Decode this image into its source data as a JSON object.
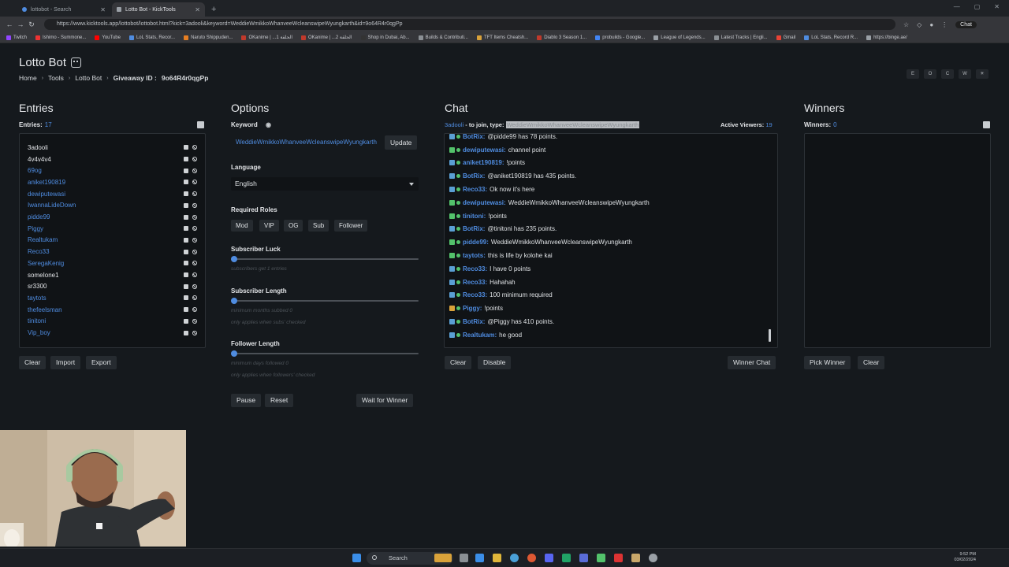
{
  "browser": {
    "tabs": [
      {
        "title": "lottobot - Search",
        "active": false
      },
      {
        "title": "Lotto Bot - KickTools",
        "active": true
      }
    ],
    "url": "https://www.kicktools.app/lottobot/lottobot.html?kick=3adooli&keyword=WeddieWmikkoWhanveeWcleanswipeWyungkarth&id=9o64R4r0qgPp",
    "chat_label": "Chat",
    "bookmarks": [
      "Twitch",
      "Ishimo - Summone...",
      "YouTube",
      "LoL Stats, Recor...",
      "Naruto Shippuden...",
      "OKanime | ...الحلقة 1",
      "OKanime | ...الحلقة 2",
      "Shop in Dubai, Ab...",
      "Builds & Contributi...",
      "TFT Items Cheatsh...",
      "Diablo 3 Season 1...",
      "probuilds - Google...",
      "League of Legends...",
      "Latest Tracks | Engli...",
      "Gmail",
      "LoL Stats, Record R...",
      "https://binge.ae/"
    ]
  },
  "header": {
    "title": "Lotto Bot",
    "breadcrumb": [
      "Home",
      "Tools",
      "Lotto Bot"
    ],
    "giveaway_label": "Giveaway ID :",
    "giveaway_id": "9o64R4r0qgPp",
    "top_buttons": [
      "E",
      "O",
      "C",
      "W",
      "☀"
    ]
  },
  "entries": {
    "title": "Entries",
    "count_label": "Entries:",
    "count": "17",
    "items": [
      {
        "name": "3adooli",
        "color": "#e3e5e8"
      },
      {
        "name": "4v4v4v4",
        "color": "#e3e5e8"
      },
      {
        "name": "69og",
        "color": "#4f8ce0"
      },
      {
        "name": "aniket190819",
        "color": "#4f8ce0"
      },
      {
        "name": "dewiputewasi",
        "color": "#4f8ce0"
      },
      {
        "name": "IwannaLideDown",
        "color": "#4f8ce0"
      },
      {
        "name": "pidde99",
        "color": "#4f8ce0"
      },
      {
        "name": "Piggy",
        "color": "#4f8ce0"
      },
      {
        "name": "Realtukam",
        "color": "#4f8ce0"
      },
      {
        "name": "Reco33",
        "color": "#4f8ce0"
      },
      {
        "name": "SeregaKenig",
        "color": "#4f8ce0"
      },
      {
        "name": "someIone1",
        "color": "#e3e5e8"
      },
      {
        "name": "sr3300",
        "color": "#e3e5e8"
      },
      {
        "name": "taytots",
        "color": "#4f8ce0"
      },
      {
        "name": "thefeelsman",
        "color": "#4f8ce0"
      },
      {
        "name": "tinitoni",
        "color": "#4f8ce0"
      },
      {
        "name": "Vip_boy",
        "color": "#4f8ce0"
      }
    ],
    "buttons": {
      "clear": "Clear",
      "import": "Import",
      "export": "Export"
    }
  },
  "options": {
    "title": "Options",
    "keyword_label": "Keyword",
    "keyword_value": "WeddieWmikkoWhanveeWcleanswipeWyungkarth",
    "update": "Update",
    "language_label": "Language",
    "language_value": "English",
    "roles_label": "Required Roles",
    "roles": [
      "Mod",
      "VIP",
      "OG",
      "Sub",
      "Follower"
    ],
    "sub_luck_label": "Subscriber Luck",
    "sub_luck_hint": "subscribers get 1 entries",
    "sub_length_label": "Subscriber Length",
    "sub_length_hint1": "minimum months subbed 0",
    "sub_length_hint2": "only applies when subs' checked",
    "follower_length_label": "Follower Length",
    "follower_length_hint1": "minimum days followed 0",
    "follower_length_hint2": "only applies when followers' checked",
    "pause": "Pause",
    "reset": "Reset",
    "wait": "Wait for Winner"
  },
  "chat": {
    "title": "Chat",
    "join_user": "3adooli",
    "join_text": "- to join, type:",
    "join_keyword": "WeddieWmikkoWhanveeWcleanswipeWyungkarth",
    "viewers_label": "Active Viewers:",
    "viewers": "19",
    "messages": [
      {
        "badge": "#5a9fd4",
        "user": "BotRix:",
        "text": "@pidde99 has 78 points.",
        "color": "#4f8ce0"
      },
      {
        "badge": "#53c26b",
        "user": "dewiputewasi:",
        "text": "channel point",
        "color": "#4f8ce0"
      },
      {
        "badge": "#5a9fd4",
        "user": "aniket190819:",
        "text": "!points",
        "color": "#4f8ce0"
      },
      {
        "badge": "#5a9fd4",
        "user": "BotRix:",
        "text": "@aniket190819 has 435 points.",
        "color": "#4f8ce0"
      },
      {
        "badge": "#5a9fd4",
        "user": "Reco33:",
        "text": "Ok now it's here",
        "color": "#4f8ce0"
      },
      {
        "badge": "#53c26b",
        "user": "dewiputewasi:",
        "text": "WeddieWmikkoWhanveeWcleanswipeWyungkarth",
        "color": "#4f8ce0"
      },
      {
        "badge": "#53c26b",
        "user": "tinitoni:",
        "text": "!points",
        "color": "#4f8ce0"
      },
      {
        "badge": "#5a9fd4",
        "user": "BotRix:",
        "text": "@tinitoni has 235 points.",
        "color": "#4f8ce0"
      },
      {
        "badge": "#53c26b",
        "user": "pidde99:",
        "text": "WeddieWmikkoWhanveeWcleanswipeWyungkarth",
        "color": "#4f8ce0"
      },
      {
        "badge": "#53c26b",
        "user": "taytots:",
        "text": "this is life by kolohe kai",
        "color": "#4f8ce0"
      },
      {
        "badge": "#5a9fd4",
        "user": "Reco33:",
        "text": "I have 0 points",
        "color": "#4f8ce0"
      },
      {
        "badge": "#5a9fd4",
        "user": "Reco33:",
        "text": "Hahahah",
        "color": "#4f8ce0"
      },
      {
        "badge": "#5a9fd4",
        "user": "Reco33:",
        "text": "100 minimum required",
        "color": "#4f8ce0"
      },
      {
        "badge": "#d9a23a",
        "user": "Piggy:",
        "text": "!points",
        "color": "#4f8ce0"
      },
      {
        "badge": "#5a9fd4",
        "user": "BotRix:",
        "text": "@Piggy has 410 points.",
        "color": "#4f8ce0"
      },
      {
        "badge": "#5a9fd4",
        "user": "Realtukam:",
        "text": "he good",
        "color": "#4f8ce0"
      }
    ],
    "clear": "Clear",
    "disable": "Disable",
    "winner_chat": "Winner Chat"
  },
  "winners": {
    "title": "Winners",
    "count_label": "Winners:",
    "count": "0",
    "pick": "Pick Winner",
    "clear": "Clear"
  },
  "taskbar": {
    "search_placeholder": "Search",
    "time": "9:52 PM",
    "date": "03/02/2024"
  }
}
